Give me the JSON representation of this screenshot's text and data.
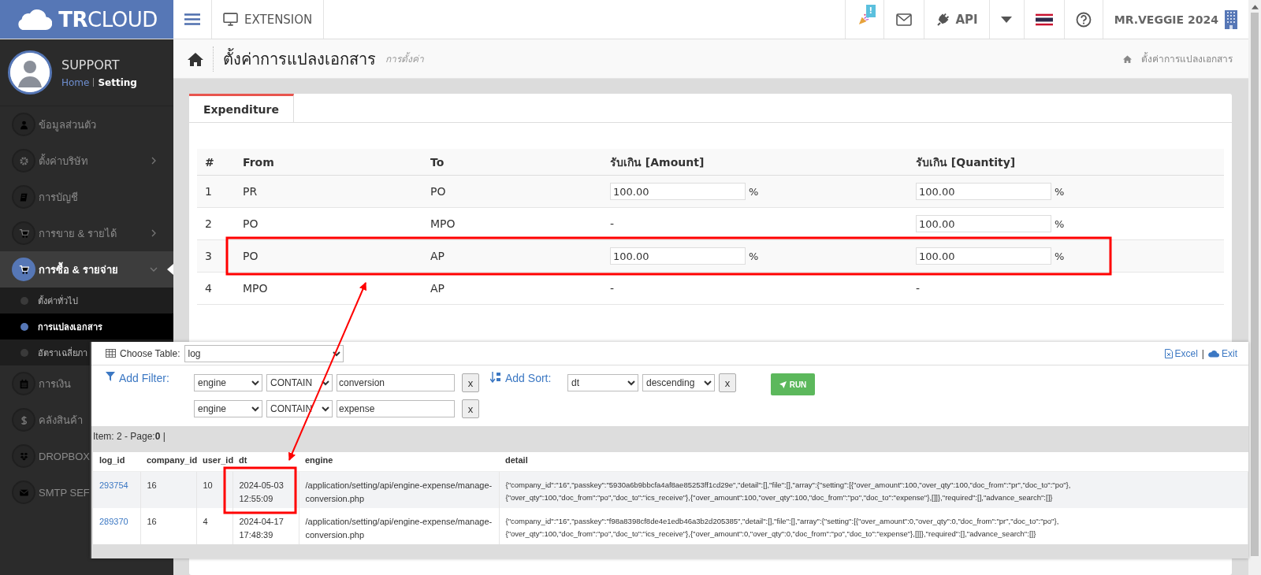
{
  "topbar": {
    "logo": "**TR**CLOUD",
    "extension": "EXTENSION",
    "notification_badge": "!",
    "api": "API",
    "user": "MR.VEGGIE 2024"
  },
  "sidebar": {
    "user": "SUPPORT",
    "links": [
      {
        "label": "Home",
        "selected": false
      },
      {
        "label": "Setting",
        "selected": true
      }
    ],
    "items": [
      {
        "label": "ข้อมูลส่วนตัว",
        "kind": "user",
        "expandable": false,
        "selected": false
      },
      {
        "label": "ตั้งค่าบริษัท",
        "kind": "gear",
        "expandable": true,
        "expanded": false,
        "selected": false
      },
      {
        "label": "การบัญชี",
        "kind": "book",
        "expandable": false,
        "selected": false
      },
      {
        "label": "การขาย & รายได้",
        "kind": "cart",
        "expandable": true,
        "expanded": false,
        "selected": false
      },
      {
        "label": "การซื้อ & รายจ่าย",
        "kind": "cart",
        "expandable": true,
        "expanded": true,
        "selected": true,
        "children": [
          {
            "label": "ตั้งค่าทั่วไป",
            "selected": false
          },
          {
            "label": "การแปลงเอกสาร",
            "selected": true
          },
          {
            "label": "อัตราเฉลี่ยภา",
            "selected": false
          }
        ]
      },
      {
        "label": "การเงิน",
        "kind": "calendar",
        "selected": false
      },
      {
        "label": "คลังสินค้า",
        "kind": "dollar",
        "selected": false
      },
      {
        "label": "DROPBOX",
        "kind": "dropbox",
        "selected": false
      },
      {
        "label": "SMTP SEF",
        "kind": "envelope",
        "selected": false
      }
    ]
  },
  "page": {
    "title": "ตั้งค่าการแปลงเอกสาร",
    "subtitle": "การตั้งค่า",
    "breadcrumb": "ตั้งค่าการแปลงเอกสาร",
    "tabs": [
      {
        "label": "Expenditure",
        "selected": true
      }
    ],
    "table": {
      "columns": [
        "#",
        "From",
        "To",
        "รับเกิน [Amount]",
        "รับเกิน [Quantity]"
      ],
      "rows": [
        {
          "cells": [
            {
              "kind": "text",
              "text": "1"
            },
            {
              "kind": "text",
              "text": "PR"
            },
            {
              "kind": "text",
              "text": "PO"
            },
            {
              "kind": "input",
              "value": "100.00",
              "unit": "%"
            },
            {
              "kind": "input",
              "value": "100.00",
              "unit": "%"
            }
          ]
        },
        {
          "cells": [
            {
              "kind": "text",
              "text": "2"
            },
            {
              "kind": "text",
              "text": "PO"
            },
            {
              "kind": "text",
              "text": "MPO"
            },
            {
              "kind": "text",
              "text": "-"
            },
            {
              "kind": "input",
              "value": "100.00",
              "unit": "%"
            }
          ]
        },
        {
          "cells": [
            {
              "kind": "text",
              "text": "3"
            },
            {
              "kind": "text",
              "text": "PO"
            },
            {
              "kind": "text",
              "text": "AP"
            },
            {
              "kind": "input",
              "value": "100.00",
              "unit": "%"
            },
            {
              "kind": "input",
              "value": "100.00",
              "unit": "%"
            }
          ]
        },
        {
          "cells": [
            {
              "kind": "text",
              "text": "4"
            },
            {
              "kind": "text",
              "text": "MPO"
            },
            {
              "kind": "text",
              "text": "AP"
            },
            {
              "kind": "text",
              "text": "-"
            },
            {
              "kind": "text",
              "text": "-"
            }
          ]
        }
      ]
    }
  },
  "log_panel": {
    "choose_table": {
      "label": "Choose Table:",
      "value": "log"
    },
    "export": "Excel",
    "separator": "|",
    "exit": "Exit",
    "filter_label": "Add Filter:",
    "filters": [
      {
        "field": "engine",
        "operator": "CONTAIN",
        "value": "conversion",
        "remove": "x"
      },
      {
        "field": "engine",
        "operator": "CONTAIN",
        "value": "expense",
        "remove": "x"
      }
    ],
    "sort_label": "Add Sort:",
    "sort": {
      "field": "dt",
      "order": "descending",
      "remove": "x"
    },
    "run": "RUN",
    "status": "Item: 2 - Page:**0** |",
    "columns": [
      "log_id",
      "company_id",
      "user_id",
      "dt",
      "engine",
      "detail"
    ],
    "rows": [
      {
        "cells": [
          "293754",
          "16",
          "10",
          "2024-05-03 12:55:09",
          "/application/setting/api/engine-expense/manage-conversion.php",
          "{\"company_id\":\"16\",\"passkey\":\"5930a6b9bbcfa4af8ae85253ff1cd29e\",\"detail\":[],\"file\":[],\"array\":{\"setting\":[{\"over_amount\":100,\"over_qty\":100,\"doc_from\":\"pr\",\"doc_to\":\"po\"},{\"over_qty\":100,\"doc_from\":\"po\",\"doc_to\":\"ics_receive\"},{\"over_amount\":100,\"over_qty\":100,\"doc_from\":\"po\",\"doc_to\":\"expense\"},[]]},\"required\":[],\"advance_search\":[]}"
        ]
      },
      {
        "cells": [
          "289370",
          "16",
          "4",
          "2024-04-17 17:48:39",
          "/application/setting/api/engine-expense/manage-conversion.php",
          "{\"company_id\":\"16\",\"passkey\":\"f98a8398cf8de4e1edb46a3b2d205385\",\"detail\":[],\"file\":[],\"array\":{\"setting\":[{\"over_amount\":0,\"over_qty\":0,\"doc_from\":\"pr\",\"doc_to\":\"po\"},{\"over_qty\":100,\"doc_from\":\"po\",\"doc_to\":\"ics_receive\"},{\"over_amount\":0,\"over_qty\":0,\"doc_from\":\"po\",\"doc_to\":\"expense\"},[]]},\"required\":[],\"advance_search\":[]}"
        ]
      }
    ]
  }
}
